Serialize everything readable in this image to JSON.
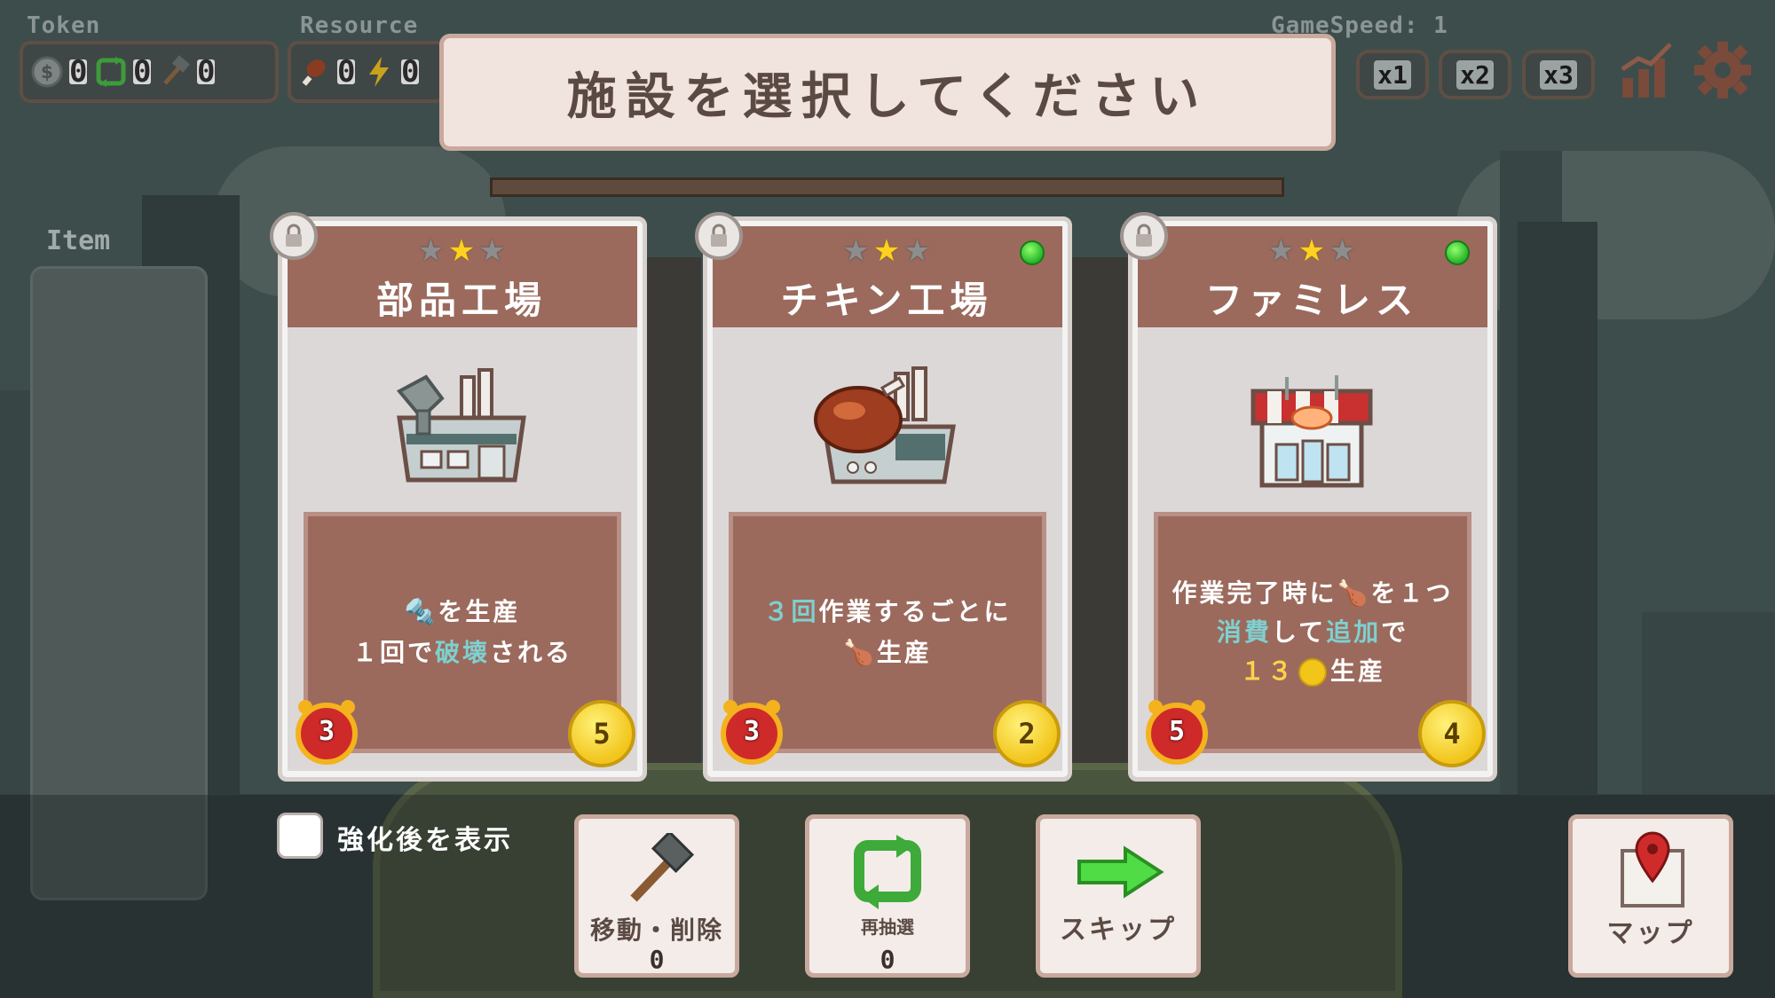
{
  "hud": {
    "token_label": "Token",
    "resource_label": "Resource",
    "gamespeed_label": "GameSpeed: 1",
    "token_items": [
      {
        "icon": "coin-icon",
        "value": "0"
      },
      {
        "icon": "refresh-icon",
        "value": "0"
      },
      {
        "icon": "hammer-icon",
        "value": "0"
      }
    ],
    "resource_items": [
      {
        "icon": "drumstick-icon",
        "value": "0"
      },
      {
        "icon": "lightning-icon",
        "value": "0"
      }
    ],
    "speed_buttons": [
      "x1",
      "x2",
      "x3"
    ]
  },
  "banner": {
    "title": "施設を選択してください"
  },
  "item_panel": {
    "label": "Item"
  },
  "cards": [
    {
      "title": "部品工場",
      "stars": 1,
      "has_leaf": false,
      "desc_line1": "を生産",
      "desc_line2a": "１回で",
      "desc_line2b": "破壊",
      "desc_line2c": "される",
      "time": "3",
      "cost": "5"
    },
    {
      "title": "チキン工場",
      "stars": 1,
      "has_leaf": true,
      "desc_line1a": "３回",
      "desc_line1b": "作業するごとに",
      "desc_line2": "生産",
      "time": "3",
      "cost": "2"
    },
    {
      "title": "ファミレス",
      "stars": 1,
      "has_leaf": true,
      "desc_line1a": "作業完了時に",
      "desc_line1b": "を１つ",
      "desc_line2a": "消費",
      "desc_line2b": "して",
      "desc_line2c": "追加",
      "desc_line2d": "で",
      "desc_line3a": "１３",
      "desc_line3b": "生産",
      "time": "5",
      "cost": "4"
    }
  ],
  "bottom": {
    "checkbox_label": "強化後を表示",
    "move_delete_label": "移動・削除",
    "move_delete_count": "0",
    "reroll_label": "再抽選",
    "reroll_count": "0",
    "skip_label": "スキップ",
    "map_label": "マップ"
  },
  "colors": {
    "card_header": "#9b6a5d",
    "banner_bg": "#f1e3dd",
    "highlight_text": "#7fd0cf",
    "gold_text": "#ffd24a"
  }
}
